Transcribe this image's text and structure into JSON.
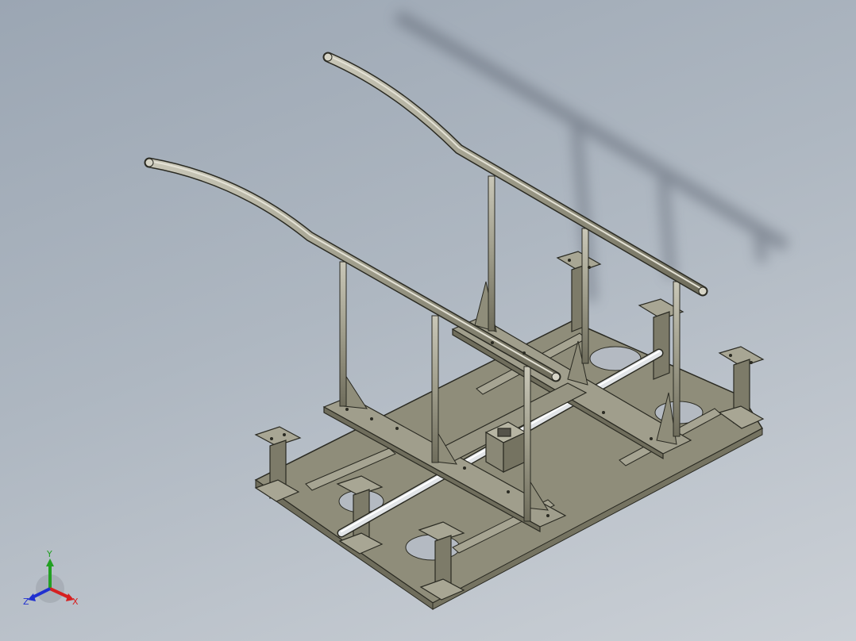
{
  "viewport": {
    "background_top": "#9ba6b3",
    "background_bottom": "#cbd0d6"
  },
  "model": {
    "part_color": "#8f8d7a",
    "part_dark": "#6f6d5c",
    "edge_color": "#2a2a22",
    "shaft_color": "#d9dcdf",
    "shadow_color": "#6e7480"
  },
  "triad": {
    "x_label": "X",
    "y_label": "Y",
    "z_label": "Z",
    "x_color": "#d62020",
    "y_color": "#22a022",
    "z_color": "#2030d0"
  }
}
